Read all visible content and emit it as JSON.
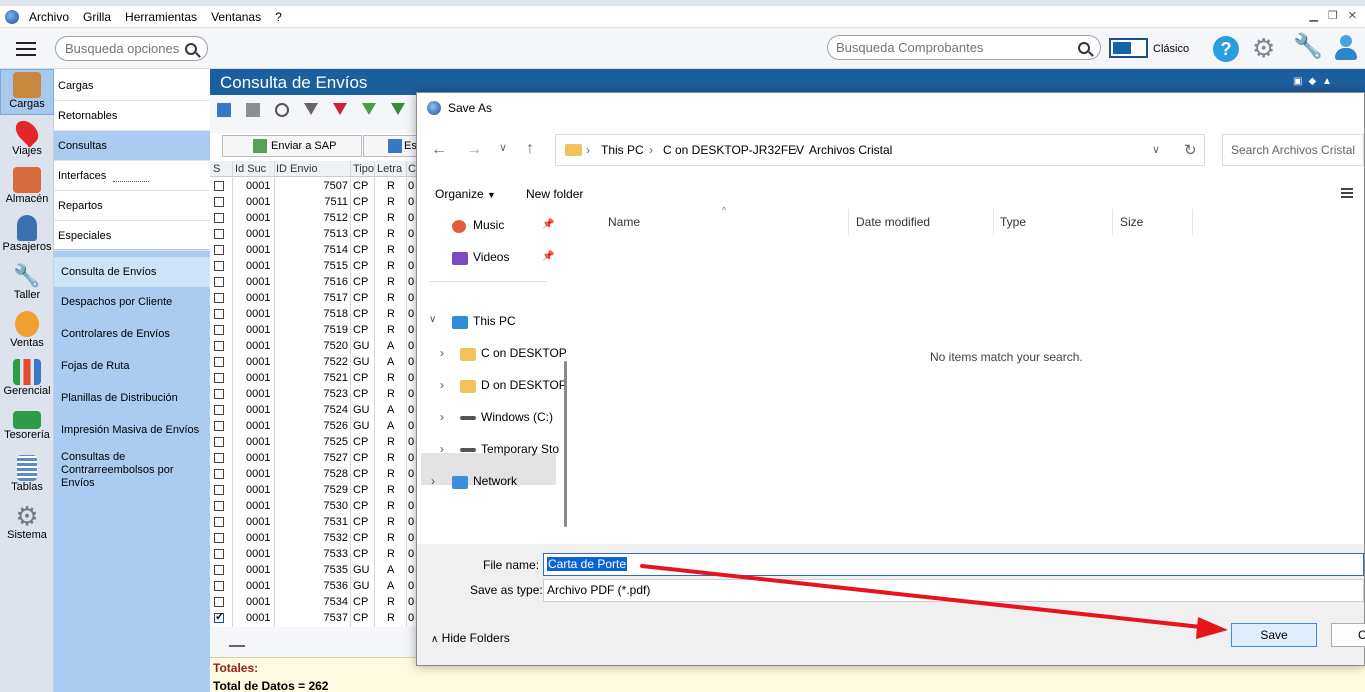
{
  "menubar": {
    "items": [
      "Archivo",
      "Grilla",
      "Herramientas",
      "Ventanas",
      "?"
    ]
  },
  "toolbar": {
    "search_opciones_placeholder": "Busqueda opciones",
    "search_comprobantes_placeholder": "Busqueda Comprobantes",
    "view_mode_label": "Clásico"
  },
  "rail": {
    "items": [
      "Cargas",
      "Viajes",
      "Almacén",
      "Pasajeros",
      "Taller",
      "Ventas",
      "Gerencial",
      "Tesorería",
      "Tablas",
      "Sistema"
    ]
  },
  "nav": {
    "level1": [
      "Cargas",
      "Retornables",
      "Consultas",
      "Interfaces",
      "Repartos",
      "Especiales"
    ],
    "level2": [
      "Consulta de Envíos",
      "Despachos por Cliente",
      "Controlares de Envíos",
      "Fojas de Ruta",
      "Planillas de Distribución",
      "Impresión Masiva de Envíos",
      "Consultas de Contrarreembolsos por Envíos"
    ]
  },
  "main": {
    "title": "Consulta de Envíos",
    "sap_button": "Enviar a SAP",
    "es_button": "Es",
    "columns": [
      "S",
      "Id Suc",
      "ID Envio",
      "Tipo",
      "Letra",
      "C"
    ],
    "rows": [
      {
        "suc": "0001",
        "id": "7507",
        "tipo": "CP",
        "letra": "R",
        "c": "0"
      },
      {
        "suc": "0001",
        "id": "7511",
        "tipo": "CP",
        "letra": "R",
        "c": "0"
      },
      {
        "suc": "0001",
        "id": "7512",
        "tipo": "CP",
        "letra": "R",
        "c": "0"
      },
      {
        "suc": "0001",
        "id": "7513",
        "tipo": "CP",
        "letra": "R",
        "c": "0"
      },
      {
        "suc": "0001",
        "id": "7514",
        "tipo": "CP",
        "letra": "R",
        "c": "0"
      },
      {
        "suc": "0001",
        "id": "7515",
        "tipo": "CP",
        "letra": "R",
        "c": "0"
      },
      {
        "suc": "0001",
        "id": "7516",
        "tipo": "CP",
        "letra": "R",
        "c": "0"
      },
      {
        "suc": "0001",
        "id": "7517",
        "tipo": "CP",
        "letra": "R",
        "c": "0"
      },
      {
        "suc": "0001",
        "id": "7518",
        "tipo": "CP",
        "letra": "R",
        "c": "0"
      },
      {
        "suc": "0001",
        "id": "7519",
        "tipo": "CP",
        "letra": "R",
        "c": "0"
      },
      {
        "suc": "0001",
        "id": "7520",
        "tipo": "GU",
        "letra": "A",
        "c": "0"
      },
      {
        "suc": "0001",
        "id": "7522",
        "tipo": "GU",
        "letra": "A",
        "c": "0"
      },
      {
        "suc": "0001",
        "id": "7521",
        "tipo": "CP",
        "letra": "R",
        "c": "0"
      },
      {
        "suc": "0001",
        "id": "7523",
        "tipo": "CP",
        "letra": "R",
        "c": "0"
      },
      {
        "suc": "0001",
        "id": "7524",
        "tipo": "GU",
        "letra": "A",
        "c": "0"
      },
      {
        "suc": "0001",
        "id": "7526",
        "tipo": "GU",
        "letra": "A",
        "c": "0"
      },
      {
        "suc": "0001",
        "id": "7525",
        "tipo": "CP",
        "letra": "R",
        "c": "0"
      },
      {
        "suc": "0001",
        "id": "7527",
        "tipo": "CP",
        "letra": "R",
        "c": "0"
      },
      {
        "suc": "0001",
        "id": "7528",
        "tipo": "CP",
        "letra": "R",
        "c": "0"
      },
      {
        "suc": "0001",
        "id": "7529",
        "tipo": "CP",
        "letra": "R",
        "c": "0"
      },
      {
        "suc": "0001",
        "id": "7530",
        "tipo": "CP",
        "letra": "R",
        "c": "0"
      },
      {
        "suc": "0001",
        "id": "7531",
        "tipo": "CP",
        "letra": "R",
        "c": "0"
      },
      {
        "suc": "0001",
        "id": "7532",
        "tipo": "CP",
        "letra": "R",
        "c": "0"
      },
      {
        "suc": "0001",
        "id": "7533",
        "tipo": "CP",
        "letra": "R",
        "c": "0"
      },
      {
        "suc": "0001",
        "id": "7535",
        "tipo": "GU",
        "letra": "A",
        "c": "0"
      },
      {
        "suc": "0001",
        "id": "7536",
        "tipo": "GU",
        "letra": "A",
        "c": "0"
      },
      {
        "suc": "0001",
        "id": "7534",
        "tipo": "CP",
        "letra": "R",
        "c": "0"
      },
      {
        "suc": "0001",
        "id": "7537",
        "tipo": "CP",
        "letra": "R",
        "c": "0",
        "checked": true
      }
    ],
    "totales_label": "Totales:",
    "total_datos": "Total de Datos = 262"
  },
  "dialog": {
    "title": "Save As",
    "breadcrumb": [
      "This PC",
      "C on DESKTOP-JR32FEV",
      "Archivos Cristal"
    ],
    "search_placeholder": "Search Archivos Cristal",
    "organize": "Organize",
    "new_folder": "New folder",
    "tree": [
      "Music",
      "Videos",
      "This PC",
      "C on DESKTOP",
      "D on DESKTOP",
      "Windows (C:)",
      "Temporary Sto",
      "Network"
    ],
    "columns": [
      "Name",
      "Date modified",
      "Type",
      "Size"
    ],
    "empty_text": "No items match your search.",
    "file_name_label": "File name:",
    "file_name_value": "Carta de Porte",
    "save_type_label": "Save as type:",
    "save_type_value": "Archivo PDF (*.pdf)",
    "hide_folders": "Hide Folders",
    "save_button": "Save",
    "cancel_button": "C"
  },
  "colors": {
    "title_bar": "#1c5f9f",
    "nav_blue": "#a9ccf0",
    "annotation_arrow": "#e8141c"
  }
}
